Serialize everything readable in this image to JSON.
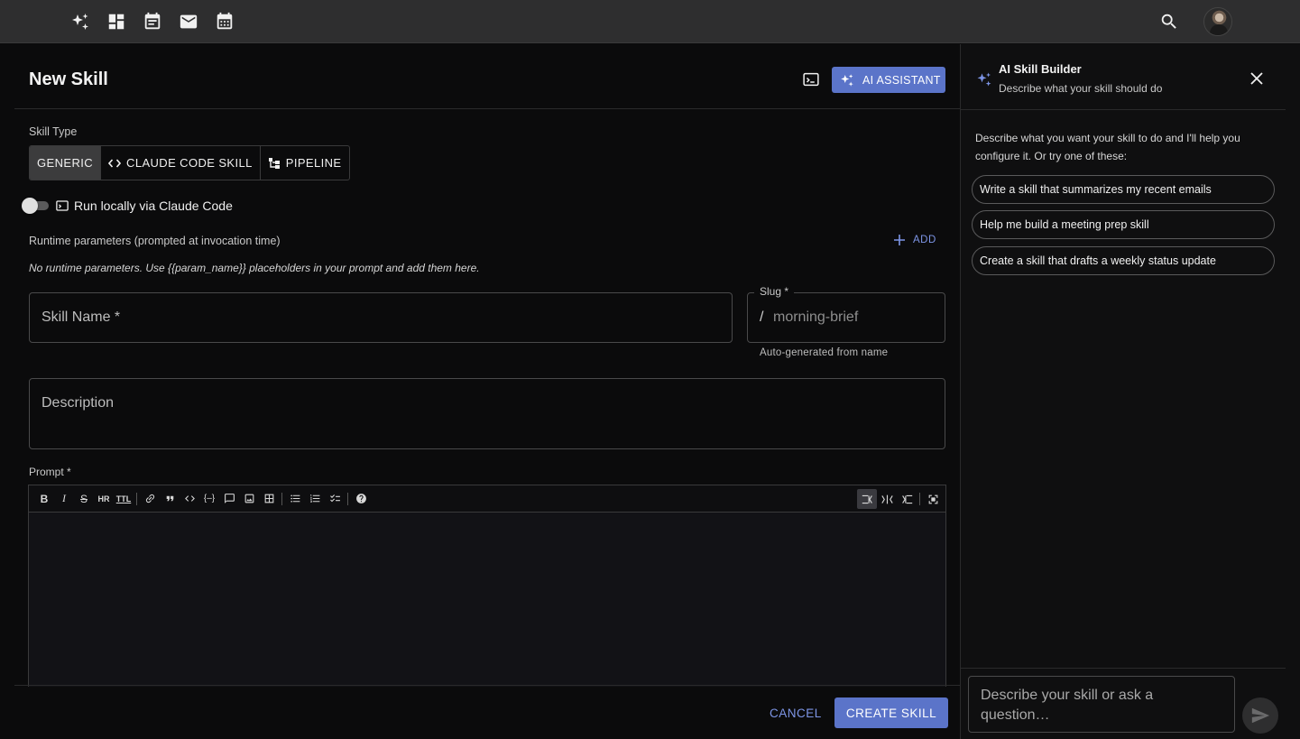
{
  "appbar": {
    "nav_icons": [
      "sparkles-icon",
      "dashboard-icon",
      "event-note-icon",
      "mail-icon",
      "calendar-icon"
    ],
    "search_icon": "search-icon",
    "avatar": "user-avatar"
  },
  "header": {
    "title": "New Skill",
    "ai_assistant_label": "AI ASSISTANT"
  },
  "form": {
    "skill_type_label": "Skill Type",
    "skill_types": [
      {
        "label": "GENERIC",
        "active": true
      },
      {
        "label": "CLAUDE CODE SKILL",
        "active": false
      },
      {
        "label": "PIPELINE",
        "active": false
      }
    ],
    "run_locally_label": "Run locally via Claude Code",
    "run_locally_on": false,
    "runtime_params_label": "Runtime parameters (prompted at invocation time)",
    "add_label": "ADD",
    "runtime_params_hint": "No runtime parameters. Use {{param_name}} placeholders in your prompt and add them here.",
    "skill_name_placeholder": "Skill Name *",
    "slug_label": "Slug *",
    "slug_prefix": "/",
    "slug_placeholder": "morning-brief",
    "slug_helper": "Auto-generated from name",
    "description_placeholder": "Description",
    "prompt_label": "Prompt *",
    "prompt_value": ""
  },
  "footer": {
    "cancel_label": "CANCEL",
    "create_label": "CREATE SKILL"
  },
  "panel": {
    "title": "AI Skill Builder",
    "subtitle": "Describe what your skill should do",
    "intro": "Describe what you want your skill to do and I'll help you configure it. Or try one of these:",
    "suggestions": [
      "Write a skill that summarizes my recent emails",
      "Help me build a meeting prep skill",
      "Create a skill that drafts a weekly status update"
    ],
    "input_placeholder": "Describe your skill or ask a question…"
  },
  "colors": {
    "accent": "#5b74c9",
    "accent_text": "#7d95e6",
    "appbar_bg": "#2e2e2f",
    "page_bg": "#0b0b0c"
  }
}
